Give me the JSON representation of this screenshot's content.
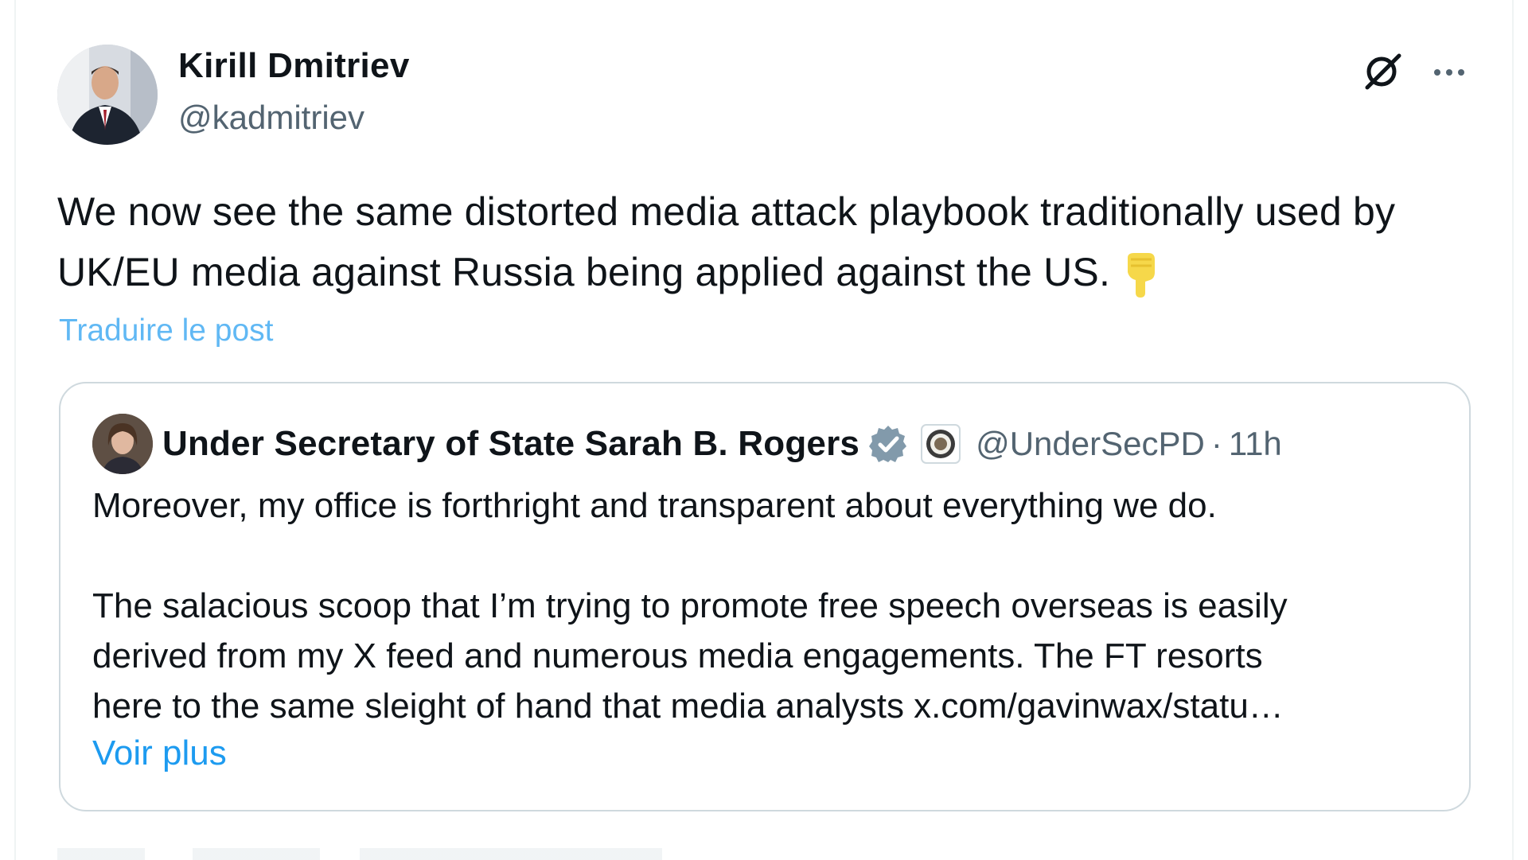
{
  "post": {
    "author_name": "Kirill Dmitriev",
    "author_handle": "@kadmitriev",
    "text": "We now see the same distorted media attack playbook traditionally used by UK/EU media against Russia being applied against the US.",
    "emoji": "pointing-down-emoji",
    "translate_label": "Traduire le post",
    "grok_icon": "grok-icon",
    "more_icon": "more-options-icon"
  },
  "quote": {
    "author_name": "Under Secretary of State Sarah B. Rogers",
    "verified_icon": "verified-badge-icon",
    "affiliate_icon": "government-seal-icon",
    "author_handle": "@UnderSecPD",
    "separator": "·",
    "time": "11h",
    "paragraph1": "Moreover, my office is forthright and transparent about everything we do.",
    "line1": "The salacious scoop that I’m trying to promote free speech overseas is easily",
    "line2": "derived from my X feed and numerous media engagements.  The FT resorts",
    "line3": "here to the same sleight of hand that media analysts x.com/gavinwax/statu…",
    "show_more_label": "Voir plus"
  },
  "colors": {
    "text": "#0f1419",
    "secondary": "#536471",
    "link": "#1d9bf0",
    "border": "#cfd9de",
    "verified": "#829aab"
  }
}
